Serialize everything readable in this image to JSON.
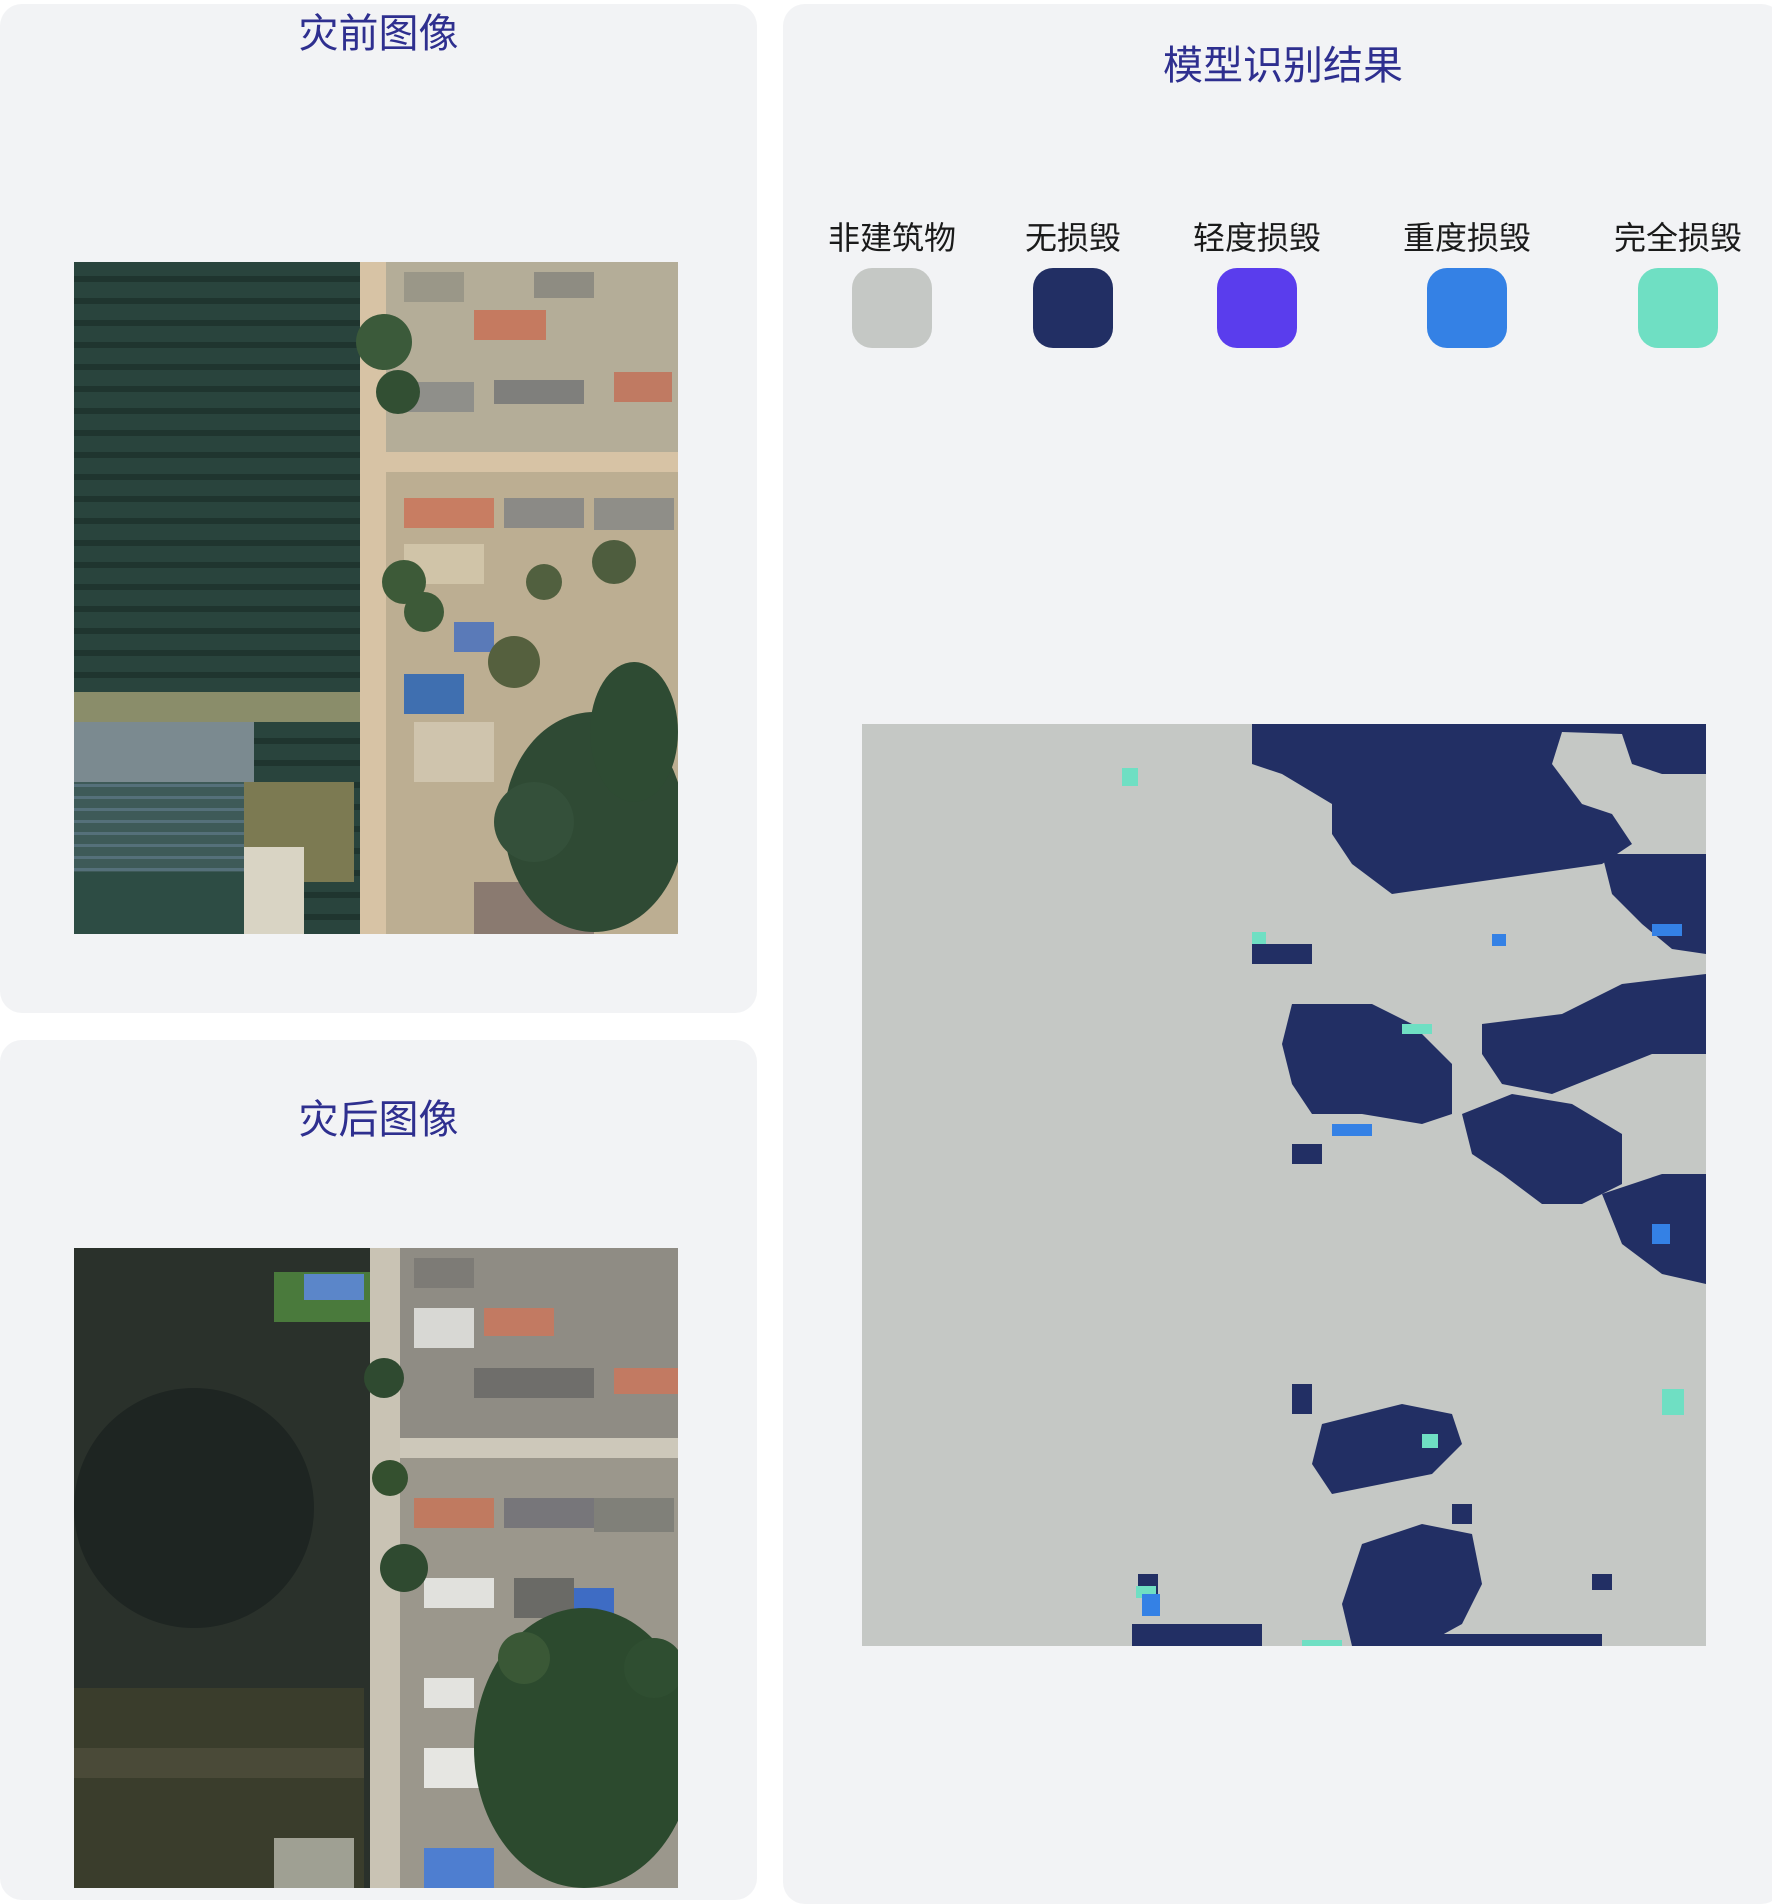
{
  "before_panel": {
    "title": "灾前图像"
  },
  "after_panel": {
    "title": "灾后图像"
  },
  "result_panel": {
    "title": "模型识别结果",
    "legend": [
      {
        "label": "非建筑物",
        "color": "#c5c8c5"
      },
      {
        "label": "无损毁",
        "color": "#222f64"
      },
      {
        "label": "轻度损毁",
        "color": "#5a3ded"
      },
      {
        "label": "重度损毁",
        "color": "#3481e5"
      },
      {
        "label": "完全损毁",
        "color": "#6fdfc3"
      }
    ]
  },
  "colors": {
    "card_background": "#f2f3f5",
    "title_color": "#2e2f8f"
  }
}
